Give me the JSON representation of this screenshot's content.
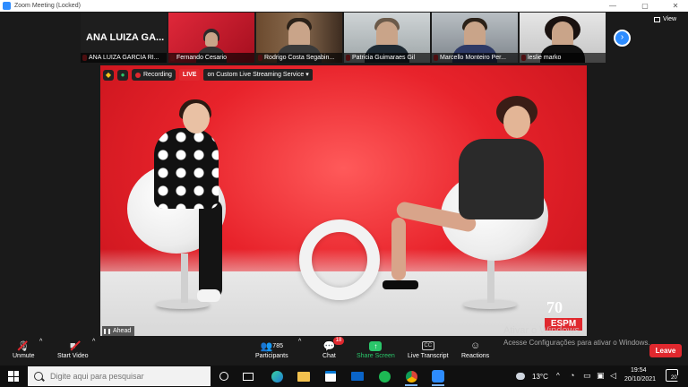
{
  "window": {
    "title": "Zoom Meeting (Locked)"
  },
  "filmstrip": {
    "name_only_tile": "ANA LUIZA GA...",
    "tiles": [
      {
        "name": "ANA LUIZA GARCIA RI..."
      },
      {
        "name": "Fernando Cesario"
      },
      {
        "name": "Rodrigo Costa Segabin..."
      },
      {
        "name": "Patricia Guimaraes Gil"
      },
      {
        "name": "Marcello Monteiro Per..."
      },
      {
        "name": "leslie marko"
      }
    ],
    "view_label": "View",
    "next_icon": "chevron-right-icon"
  },
  "stage": {
    "recording_label": "Recording",
    "live_label": "LIVE",
    "service_label": "on Custom Live Streaming Service",
    "speaker_label": "Ahead",
    "logo_number": "70",
    "logo_text": "ESPM"
  },
  "watermark": {
    "line1": "Ativar o Windows",
    "line2": "Acesse Configurações para ativar o Windows."
  },
  "toolbar": {
    "unmute": "Unmute",
    "start_video": "Start Video",
    "participants": "Participants",
    "participants_count": "785",
    "chat": "Chat",
    "chat_badge": "18",
    "share_screen": "Share Screen",
    "live_transcript": "Live Transcript",
    "cc": "CC",
    "reactions": "Reactions",
    "leave": "Leave"
  },
  "taskbar": {
    "search_placeholder": "Digite aqui para pesquisar",
    "temperature": "13°C",
    "time": "19:54",
    "date": "20/10/2021",
    "notification_count": "20"
  },
  "colors": {
    "accent": "#2d8cff",
    "danger": "#e0282e",
    "share": "#2ac66a"
  }
}
